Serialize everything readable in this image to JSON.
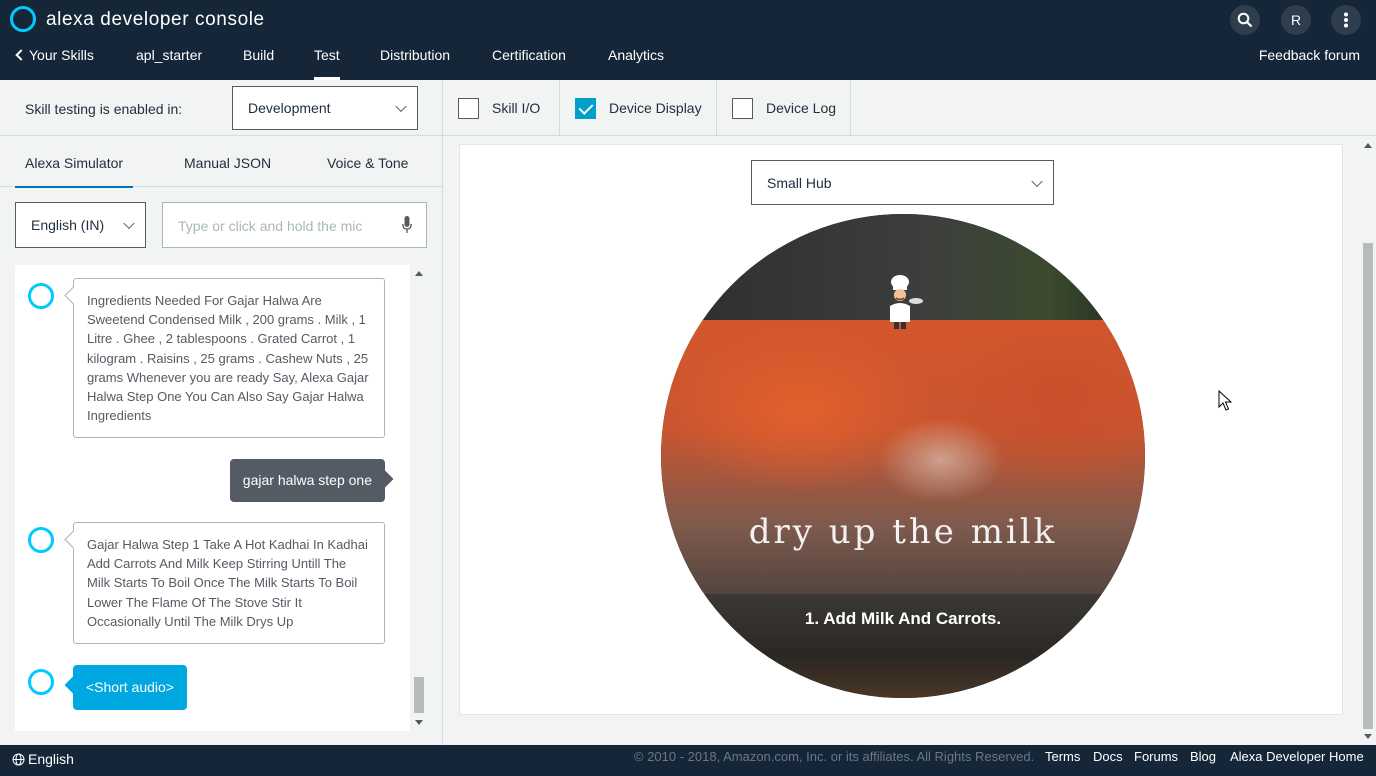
{
  "header": {
    "brand": "alexa developer console",
    "back_label": "Your Skills",
    "nav": [
      "apl_starter",
      "Build",
      "Test",
      "Distribution",
      "Certification",
      "Analytics"
    ],
    "active_nav": "Test",
    "feedback": "Feedback forum",
    "avatar_initial": "R"
  },
  "toolbar": {
    "label": "Skill testing is enabled in:",
    "stage_value": "Development",
    "checkboxes": [
      {
        "label": "Skill I/O",
        "checked": false
      },
      {
        "label": "Device Display",
        "checked": true
      },
      {
        "label": "Device Log",
        "checked": false
      }
    ]
  },
  "simulator": {
    "tabs": [
      "Alexa Simulator",
      "Manual JSON",
      "Voice & Tone"
    ],
    "active_tab": "Alexa Simulator",
    "locale": "English (IN)",
    "input_placeholder": "Type or click and hold the mic",
    "messages": [
      {
        "from": "alexa",
        "text": "Ingredients Needed For Gajar Halwa Are Sweetend Condensed Milk , 200 grams . Milk , 1 Litre . Ghee , 2 tablespoons . Grated Carrot , 1 kilogram . Raisins , 25 grams . Cashew Nuts , 25 grams Whenever you are ready Say, Alexa Gajar Halwa Step One You Can Also Say Gajar Halwa Ingredients"
      },
      {
        "from": "user",
        "text": "gajar halwa step one"
      },
      {
        "from": "alexa",
        "text": "Gajar Halwa Step 1 Take A Hot Kadhai In Kadhai Add Carrots And Milk Keep Stirring Untill The Milk Starts To Boil Once The Milk Starts To Boil Lower The Flame Of The Stove Stir It Occasionally Until The Milk Drys Up"
      },
      {
        "from": "alexa-audio",
        "text": "<Short audio>"
      }
    ]
  },
  "display": {
    "device": "Small Hub",
    "overlay_text": "dry up the milk",
    "step_text": "1. Add Milk And Carrots."
  },
  "footer": {
    "language": "English",
    "copyright": "© 2010 - 2018, Amazon.com, Inc. or its affiliates. All Rights Reserved.",
    "links": [
      "Terms",
      "Docs",
      "Forums",
      "Blog",
      "Alexa Developer Home"
    ]
  },
  "colors": {
    "header_bg": "#152638",
    "accent": "#00caff",
    "checkbox_checked": "#00a1c9",
    "audio_bubble": "#00a8e1"
  }
}
